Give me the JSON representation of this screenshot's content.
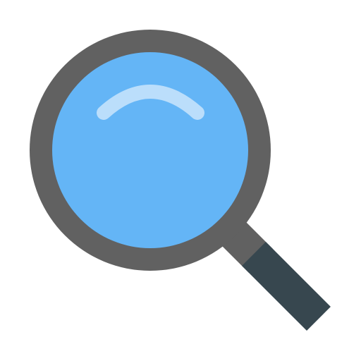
{
  "icon": {
    "name": "search-icon",
    "colors": {
      "rim": "#616161",
      "lens": "#64B5F6",
      "glare": "#BBDEFB",
      "handle_grip": "#37474F",
      "background": "#FFFFFF"
    }
  }
}
